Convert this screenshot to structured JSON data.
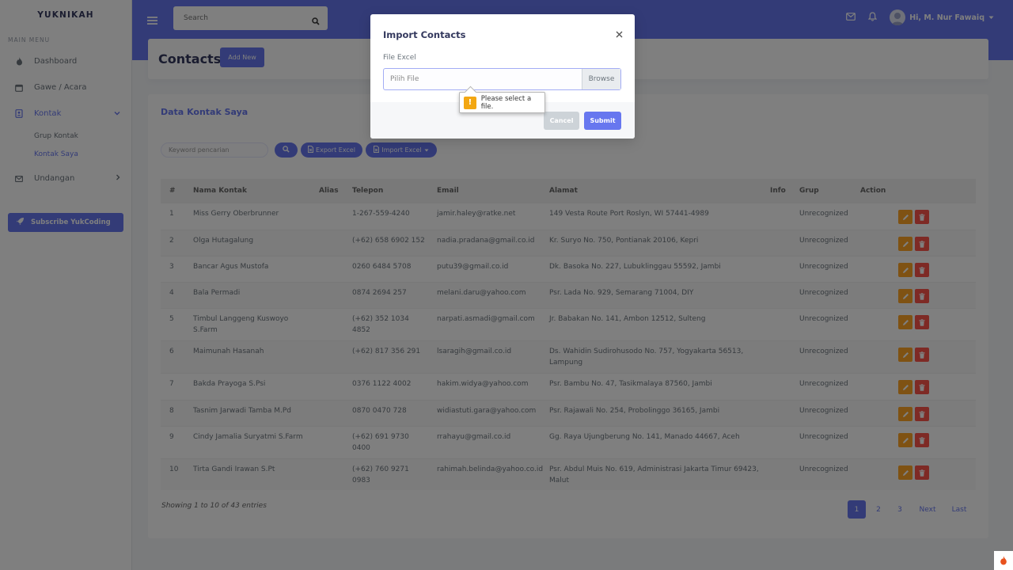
{
  "sidebar": {
    "brand": "YUKNIKAH",
    "menu_header": "MAIN MENU",
    "items": [
      {
        "label": "Dashboard",
        "icon": "fire-icon"
      },
      {
        "label": "Gawe / Acara",
        "icon": "calendar-icon"
      },
      {
        "label": "Kontak",
        "icon": "address-book-icon",
        "active": true
      },
      {
        "label": "Undangan",
        "icon": "envelope-icon"
      }
    ],
    "sub_items": [
      {
        "label": "Grup Kontak"
      },
      {
        "label": "Kontak Saya",
        "active": true
      }
    ],
    "subscribe_label": "Subscribe YukCoding"
  },
  "navbar": {
    "search_placeholder": "Search",
    "user_name": "Hi, M. Nur Fawaiq"
  },
  "header": {
    "title": "Contacts",
    "add_label": "Add New"
  },
  "card": {
    "title": "Data Kontak Saya",
    "keyword_placeholder": "Keyword pencarian",
    "export_label": "Export Excel",
    "import_label": "Import Excel"
  },
  "table": {
    "columns": [
      "#",
      "Nama Kontak",
      "Alias",
      "Telepon",
      "Email",
      "Alamat",
      "Info",
      "Grup",
      "Action"
    ],
    "rows": [
      {
        "no": "1",
        "name": "Miss Gerry Oberbrunner",
        "alias": "",
        "phone": "1-267-559-4240",
        "email": "jamir.haley@ratke.net",
        "address": "149 Vesta Route Port Roslyn, WI 57441-4989",
        "info": "",
        "group": "Unrecognized"
      },
      {
        "no": "2",
        "name": "Olga Hutagalung",
        "alias": "",
        "phone": "(+62) 658 6902 152",
        "email": "nadia.pradana@gmail.co.id",
        "address": "Kr. Suryo No. 750, Pontianak 20106, Kepri",
        "info": "",
        "group": "Unrecognized"
      },
      {
        "no": "3",
        "name": "Bancar Agus Mustofa",
        "alias": "",
        "phone": "0260 6484 5708",
        "email": "putu39@gmail.co.id",
        "address": "Dk. Basoka No. 227, Lubuklinggau 55592, Jambi",
        "info": "",
        "group": "Unrecognized"
      },
      {
        "no": "4",
        "name": "Bala Permadi",
        "alias": "",
        "phone": "0874 2694 257",
        "email": "melani.daru@yahoo.com",
        "address": "Psr. Lada No. 929, Semarang 71004, DIY",
        "info": "",
        "group": "Unrecognized"
      },
      {
        "no": "5",
        "name": "Timbul Langgeng Kuswoyo S.Farm",
        "alias": "",
        "phone": "(+62) 352 1034 4852",
        "email": "narpati.asmadi@gmail.com",
        "address": "Jr. Babakan No. 141, Ambon 12512, Sulteng",
        "info": "",
        "group": "Unrecognized"
      },
      {
        "no": "6",
        "name": "Maimunah Hasanah",
        "alias": "",
        "phone": "(+62) 817 356 291",
        "email": "lsaragih@gmail.co.id",
        "address": "Ds. Wahidin Sudirohusodo No. 757, Yogyakarta 56513, Lampung",
        "info": "",
        "group": "Unrecognized"
      },
      {
        "no": "7",
        "name": "Bakda Prayoga S.Psi",
        "alias": "",
        "phone": "0376 1122 4002",
        "email": "hakim.widya@yahoo.com",
        "address": "Psr. Bambu No. 47, Tasikmalaya 87560, Jambi",
        "info": "",
        "group": "Unrecognized"
      },
      {
        "no": "8",
        "name": "Tasnim Jarwadi Tamba M.Pd",
        "alias": "",
        "phone": "0870 0470 728",
        "email": "widiastuti.gara@yahoo.com",
        "address": "Psr. Rajawali No. 254, Probolinggo 36165, Jambi",
        "info": "",
        "group": "Unrecognized"
      },
      {
        "no": "9",
        "name": "Cindy Jamalia Suryatmi S.Farm",
        "alias": "",
        "phone": "(+62) 691 9730 0400",
        "email": "rrahayu@gmail.co.id",
        "address": "Gg. Raya Ujungberung No. 141, Manado 44667, Aceh",
        "info": "",
        "group": "Unrecognized"
      },
      {
        "no": "10",
        "name": "Tirta Gandi Irawan S.Pt",
        "alias": "",
        "phone": "(+62) 760 9271 0983",
        "email": "rahimah.belinda@yahoo.co.id",
        "address": "Psr. Abdul Muis No. 619, Administrasi Jakarta Timur 69423, Malut",
        "info": "",
        "group": "Unrecognized"
      }
    ],
    "showing": "Showing 1 to 10 of 43 entries",
    "pages": [
      "1",
      "2",
      "3",
      "Next",
      "Last"
    ],
    "current_page": "1"
  },
  "modal": {
    "title": "Import Contacts",
    "field_label": "File Excel",
    "file_placeholder": "Pilih File",
    "browse_label": "Browse",
    "tooltip": "Please select a file.",
    "cancel_label": "Cancel",
    "submit_label": "Submit"
  },
  "colors": {
    "primary": "#6777ef",
    "warning": "#ffa426",
    "danger": "#fc544b"
  }
}
